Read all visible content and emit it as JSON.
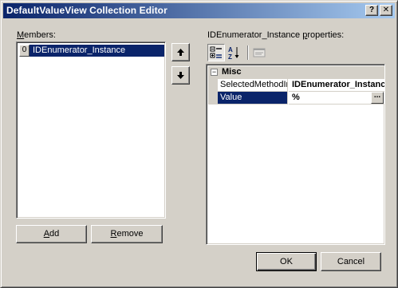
{
  "window": {
    "title": "DefaultValueView Collection Editor",
    "help_glyph": "?",
    "close_glyph": "✕"
  },
  "members": {
    "label": "Members:",
    "label_accesskey": "M",
    "label_rest": "embers:",
    "items": [
      {
        "index": "0",
        "label": "IDEnumerator_Instance"
      }
    ]
  },
  "buttons": {
    "add": "Add",
    "add_accesskey": "A",
    "add_rest": "dd",
    "remove": "Remove",
    "remove_accesskey": "R",
    "remove_rest": "emove",
    "ok": "OK",
    "cancel": "Cancel"
  },
  "properties": {
    "title": "IDEnumerator_Instance properties:",
    "title_prefix": "IDEnumerator_Instance ",
    "title_accesskey": "p",
    "title_rest": "roperties:",
    "category": {
      "toggle": "−",
      "label": "Misc"
    },
    "rows": [
      {
        "name": "SelectedMethodIn",
        "value": "IDEnumerator_Instance",
        "selected": false
      },
      {
        "name": "Value",
        "value": "%",
        "selected": true,
        "ellipsis": "..."
      }
    ]
  },
  "colors": {
    "selection": "#0a246a",
    "face": "#d4d0c8",
    "title_gradient_end": "#a6caf0"
  },
  "icons": [
    "move-up-arrow-icon",
    "move-down-arrow-icon",
    "categorized-icon",
    "alphabetical-icon",
    "property-pages-icon"
  ]
}
